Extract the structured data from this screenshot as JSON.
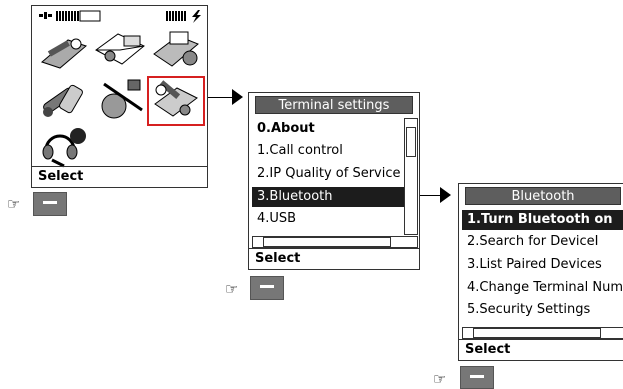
{
  "home": {
    "softkey": "Select",
    "icons": [
      "tools-icon",
      "messages-icon",
      "phonebook-icon",
      "terminal-settings-icon",
      "calls-icon",
      "network-icon",
      "terminal-settings-icon",
      "headset-icon"
    ]
  },
  "terminal_settings": {
    "title": "Terminal settings",
    "softkey": "Select",
    "items": [
      {
        "label": "0.About"
      },
      {
        "label": "1.Call control"
      },
      {
        "label": "2.IP Quality of Service"
      },
      {
        "label": "3.Bluetooth"
      },
      {
        "label": "4.USB"
      }
    ]
  },
  "bluetooth": {
    "title": "Bluetooth",
    "softkey": "Select",
    "items": [
      {
        "label": "1.Turn Bluetooth on"
      },
      {
        "label": "2.Search for DeviceI"
      },
      {
        "label": "3.List Paired Devices"
      },
      {
        "label": "4.Change Terminal Num"
      },
      {
        "label": "5.Security Settings"
      }
    ]
  },
  "colors": {
    "highlight": "#1c1c1c",
    "title_bar": "#5e5e5e",
    "selection_box": "#d62020",
    "soft_button": "#777777"
  }
}
